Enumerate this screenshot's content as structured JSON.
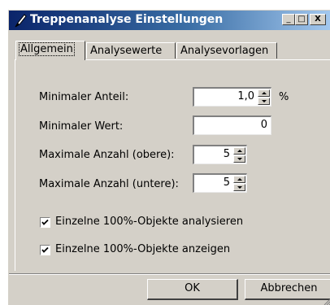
{
  "window": {
    "title": "Treppenanalyse Einstellungen",
    "minimize_glyph": "_",
    "maximize_glyph": "□",
    "close_glyph": "X"
  },
  "tabs": [
    {
      "label": "Allgemein",
      "active": true
    },
    {
      "label": "Analysewerte",
      "active": false
    },
    {
      "label": "Analysevorlagen",
      "active": false
    }
  ],
  "form": {
    "min_share": {
      "label": "Minimaler Anteil:",
      "value": "1,0",
      "unit": "%"
    },
    "min_value": {
      "label": "Minimaler Wert:",
      "value": "0"
    },
    "max_upper": {
      "label": "Maximale Anzahl (obere):",
      "value": "5"
    },
    "max_lower": {
      "label": "Maximale Anzahl (untere):",
      "value": "5"
    },
    "checks": [
      {
        "label": "Einzelne 100%-Objekte analysieren",
        "checked": true
      },
      {
        "label": "Einzelne 100%-Objekte anzeigen",
        "checked": true
      }
    ]
  },
  "buttons": {
    "ok": "OK",
    "cancel": "Abbrechen"
  },
  "icons": {
    "app": "pen-icon",
    "check": "checkmark-icon"
  },
  "colors": {
    "titlebar_start": "#0a246a",
    "titlebar_end": "#a6caf0",
    "face": "#d4d0c8"
  }
}
